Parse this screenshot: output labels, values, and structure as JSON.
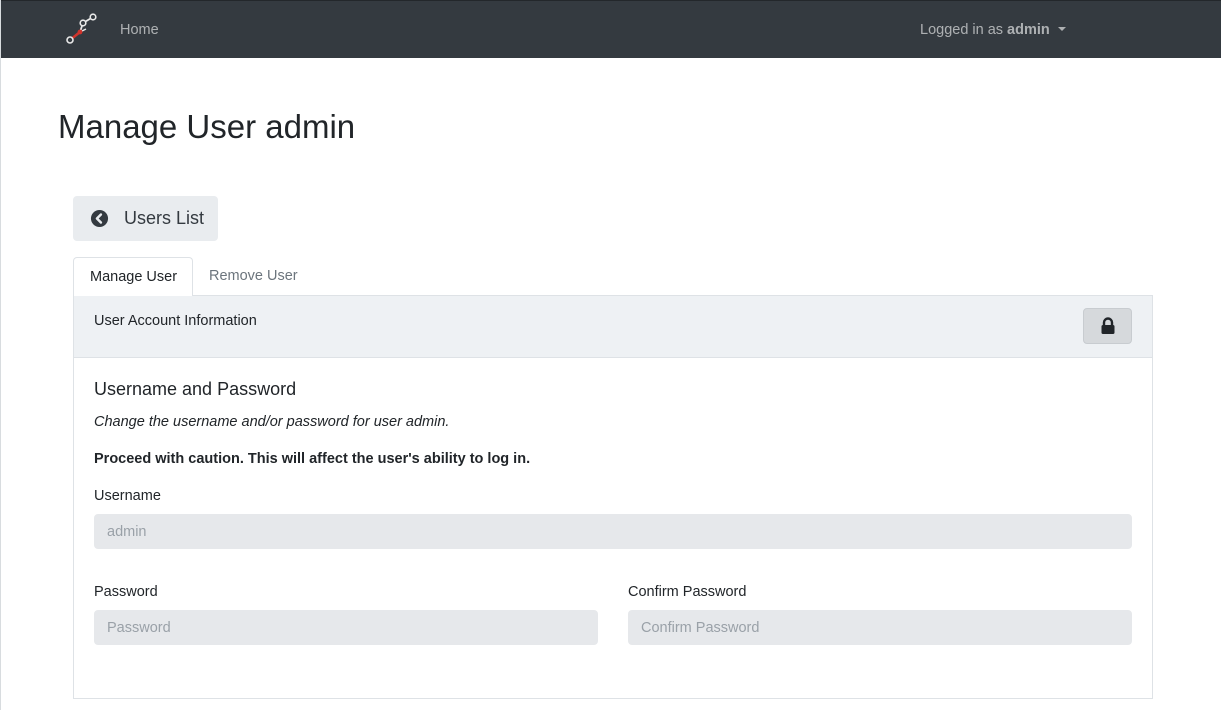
{
  "navbar": {
    "home_label": "Home",
    "logged_in_prefix": "Logged in as",
    "username": "admin"
  },
  "page": {
    "title": "Manage User admin"
  },
  "back_button": {
    "label": "Users List",
    "icon": "chevron-circle-left-icon"
  },
  "tabs": [
    {
      "label": "Manage User",
      "active": true
    },
    {
      "label": "Remove User",
      "active": false
    }
  ],
  "card": {
    "header_title": "User Account Information",
    "lock_icon": "lock-icon",
    "section_title": "Username and Password",
    "description": "Change the username and/or password for user admin.",
    "warning": "Proceed with caution. This will affect the user's ability to log in."
  },
  "form": {
    "username": {
      "label": "Username",
      "placeholder": "admin"
    },
    "password": {
      "label": "Password",
      "placeholder": "Password"
    },
    "confirm_password": {
      "label": "Confirm Password",
      "placeholder": "Confirm Password"
    }
  },
  "colors": {
    "navbar_bg": "#343a40",
    "logo_accent": "#d0342c"
  }
}
